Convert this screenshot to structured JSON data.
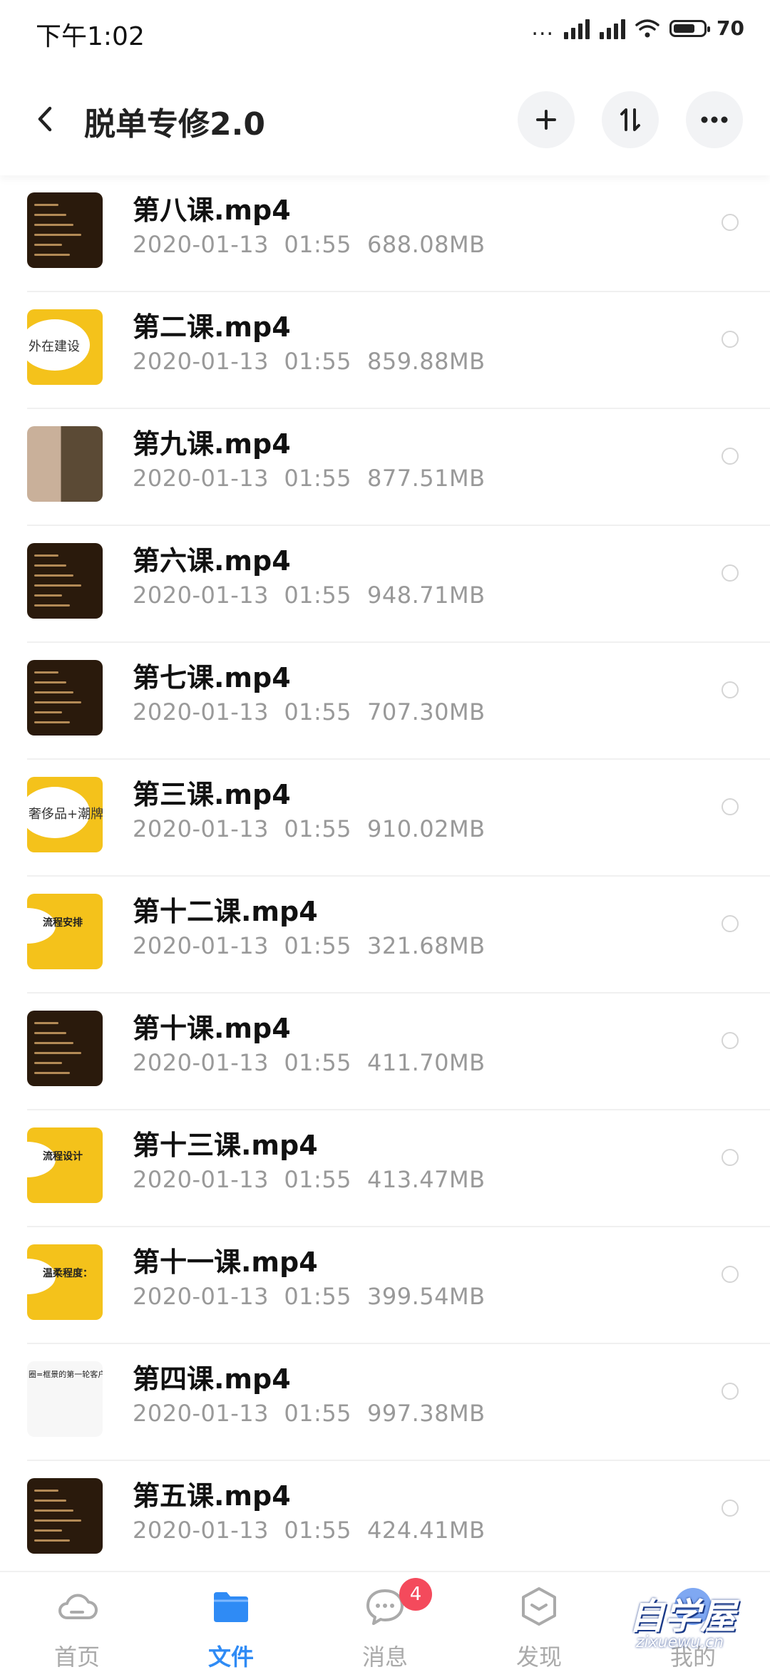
{
  "status": {
    "time": "下午1:02",
    "signal_dots": "...",
    "battery": "70"
  },
  "header": {
    "title": "脱单专修2.0"
  },
  "files": [
    {
      "name": "第八课.mp4",
      "date": "2020-01-13  01:55",
      "size": "688.08MB",
      "thumb": "dark"
    },
    {
      "name": "第二课.mp4",
      "date": "2020-01-13  01:55",
      "size": "859.88MB",
      "thumb": "yellow-text",
      "thumb_text": "外在建设"
    },
    {
      "name": "第九课.mp4",
      "date": "2020-01-13  01:55",
      "size": "877.51MB",
      "thumb": "photo"
    },
    {
      "name": "第六课.mp4",
      "date": "2020-01-13  01:55",
      "size": "948.71MB",
      "thumb": "dark"
    },
    {
      "name": "第七课.mp4",
      "date": "2020-01-13  01:55",
      "size": "707.30MB",
      "thumb": "dark"
    },
    {
      "name": "第三课.mp4",
      "date": "2020-01-13  01:55",
      "size": "910.02MB",
      "thumb": "yellow-text",
      "thumb_text": "奢侈品+潮牌"
    },
    {
      "name": "第十二课.mp4",
      "date": "2020-01-13  01:55",
      "size": "321.68MB",
      "thumb": "yellow-heading",
      "thumb_text": "流程安排"
    },
    {
      "name": "第十课.mp4",
      "date": "2020-01-13  01:55",
      "size": "411.70MB",
      "thumb": "dark"
    },
    {
      "name": "第十三课.mp4",
      "date": "2020-01-13  01:55",
      "size": "413.47MB",
      "thumb": "yellow-heading",
      "thumb_text": "流程设计"
    },
    {
      "name": "第十一课.mp4",
      "date": "2020-01-13  01:55",
      "size": "399.54MB",
      "thumb": "yellow-heading",
      "thumb_text": "温柔程度："
    },
    {
      "name": "第四课.mp4",
      "date": "2020-01-13  01:55",
      "size": "997.38MB",
      "thumb": "white",
      "thumb_text": "圈=框景的第一轮客户"
    },
    {
      "name": "第五课.mp4",
      "date": "2020-01-13  01:55",
      "size": "424.41MB",
      "thumb": "dark"
    }
  ],
  "nav": {
    "home": "首页",
    "files": "文件",
    "messages": "消息",
    "messages_badge": "4",
    "discover": "发现",
    "mine": "我的"
  },
  "watermark": {
    "title": "自学屋",
    "url": "zixuewu.cn"
  },
  "colors": {
    "accent": "#2f8bf5",
    "badge": "#f44a5c",
    "thumb_yellow": "#f4c21b",
    "thumb_dark": "#2a1a0c"
  }
}
